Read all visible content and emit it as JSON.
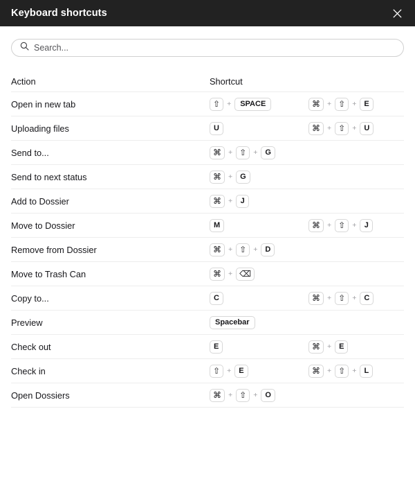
{
  "titlebar": {
    "title": "Keyboard shortcuts",
    "close_icon": "close-icon"
  },
  "search": {
    "placeholder": "Search...",
    "value": "",
    "icon": "search-icon"
  },
  "table": {
    "headers": {
      "action": "Action",
      "shortcut": "Shortcut"
    },
    "rows": [
      {
        "action": "Open in new tab",
        "primary": [
          "⇧",
          "SPACE"
        ],
        "secondary": [
          "⌘",
          "⇧",
          "E"
        ]
      },
      {
        "action": "Uploading files",
        "primary": [
          "U"
        ],
        "secondary": [
          "⌘",
          "⇧",
          "U"
        ]
      },
      {
        "action": "Send to...",
        "primary": [
          "⌘",
          "⇧",
          "G"
        ],
        "secondary": []
      },
      {
        "action": "Send to next status",
        "primary": [
          "⌘",
          "G"
        ],
        "secondary": []
      },
      {
        "action": "Add to Dossier",
        "primary": [
          "⌘",
          "J"
        ],
        "secondary": []
      },
      {
        "action": "Move to Dossier",
        "primary": [
          "M"
        ],
        "secondary": [
          "⌘",
          "⇧",
          "J"
        ]
      },
      {
        "action": "Remove from Dossier",
        "primary": [
          "⌘",
          "⇧",
          "D"
        ],
        "secondary": []
      },
      {
        "action": "Move to Trash Can",
        "primary": [
          "⌘",
          "⌫"
        ],
        "secondary": []
      },
      {
        "action": "Copy to...",
        "primary": [
          "C"
        ],
        "secondary": [
          "⌘",
          "⇧",
          "C"
        ]
      },
      {
        "action": "Preview",
        "primary": [
          "Spacebar"
        ],
        "secondary": []
      },
      {
        "action": "Check out",
        "primary": [
          "E"
        ],
        "secondary": [
          "⌘",
          "E"
        ]
      },
      {
        "action": "Check in",
        "primary": [
          "⇧",
          "E"
        ],
        "secondary": [
          "⌘",
          "⇧",
          "L"
        ]
      },
      {
        "action": "Open Dossiers",
        "primary": [
          "⌘",
          "⇧",
          "O"
        ],
        "secondary": []
      }
    ],
    "separator": "+"
  },
  "colors": {
    "titlebar_bg": "#222222",
    "titlebar_text": "#ffffff",
    "page_bg": "#ffffff",
    "divider": "#ededed",
    "key_border": "#d8d8d8",
    "text": "#16161a",
    "placeholder": "#56565a"
  }
}
